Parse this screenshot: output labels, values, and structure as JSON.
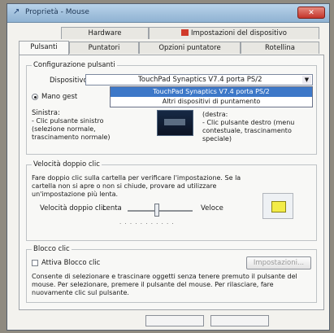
{
  "window": {
    "title": "Proprietà - Mouse",
    "close_label": "✕"
  },
  "tabs": {
    "row1": [
      "Hardware",
      "Impostazioni del dispositivo"
    ],
    "row2": [
      "Pulsanti",
      "Puntatori",
      "Opzioni puntatore",
      "Rotellina"
    ]
  },
  "button_config": {
    "group_label": "Configurazione pulsanti",
    "device_label": "Dispositivo:",
    "device_value": "TouchPad Synaptics V7.4 porta PS/2",
    "dropdown_options": [
      "TouchPad Synaptics V7.4 porta PS/2",
      "Altri dispositivi di puntamento"
    ],
    "hand_label": "Mano gest",
    "left_heading": "Sinistra:",
    "left_desc": "- Clic pulsante sinistro\n(selezione normale,\ntrascinamento normale)",
    "right_desc": "(destra:\n- Clic pulsante destro (menu\ncontestuale, trascinamento\nspeciale)"
  },
  "double_click": {
    "group_label": "Velocità doppio clic",
    "description": "Fare doppio clic sulla cartella per verificare l'impostazione. Se la\ncartella non si apre o non si chiude, provare ad utilizzare\nun'impostazione più lenta.",
    "speed_label": "Velocità doppio clic",
    "slow_label": "Lenta",
    "fast_label": "Veloce",
    "speed_fraction": 0.45
  },
  "click_lock": {
    "group_label": "Blocco clic",
    "checkbox_label": "Attiva Blocco clic",
    "settings_button": "Impostazioni...",
    "description": "Consente di selezionare e trascinare oggetti senza tenere premuto il pulsante del\nmouse. Per selezionare, premere il pulsante del mouse. Per rilasciare, fare\nnuovamente clic sul pulsante."
  },
  "colors": {
    "accent": "#3d78c8",
    "title_bar": "#a8c6e3",
    "close_button": "#c4342a"
  }
}
